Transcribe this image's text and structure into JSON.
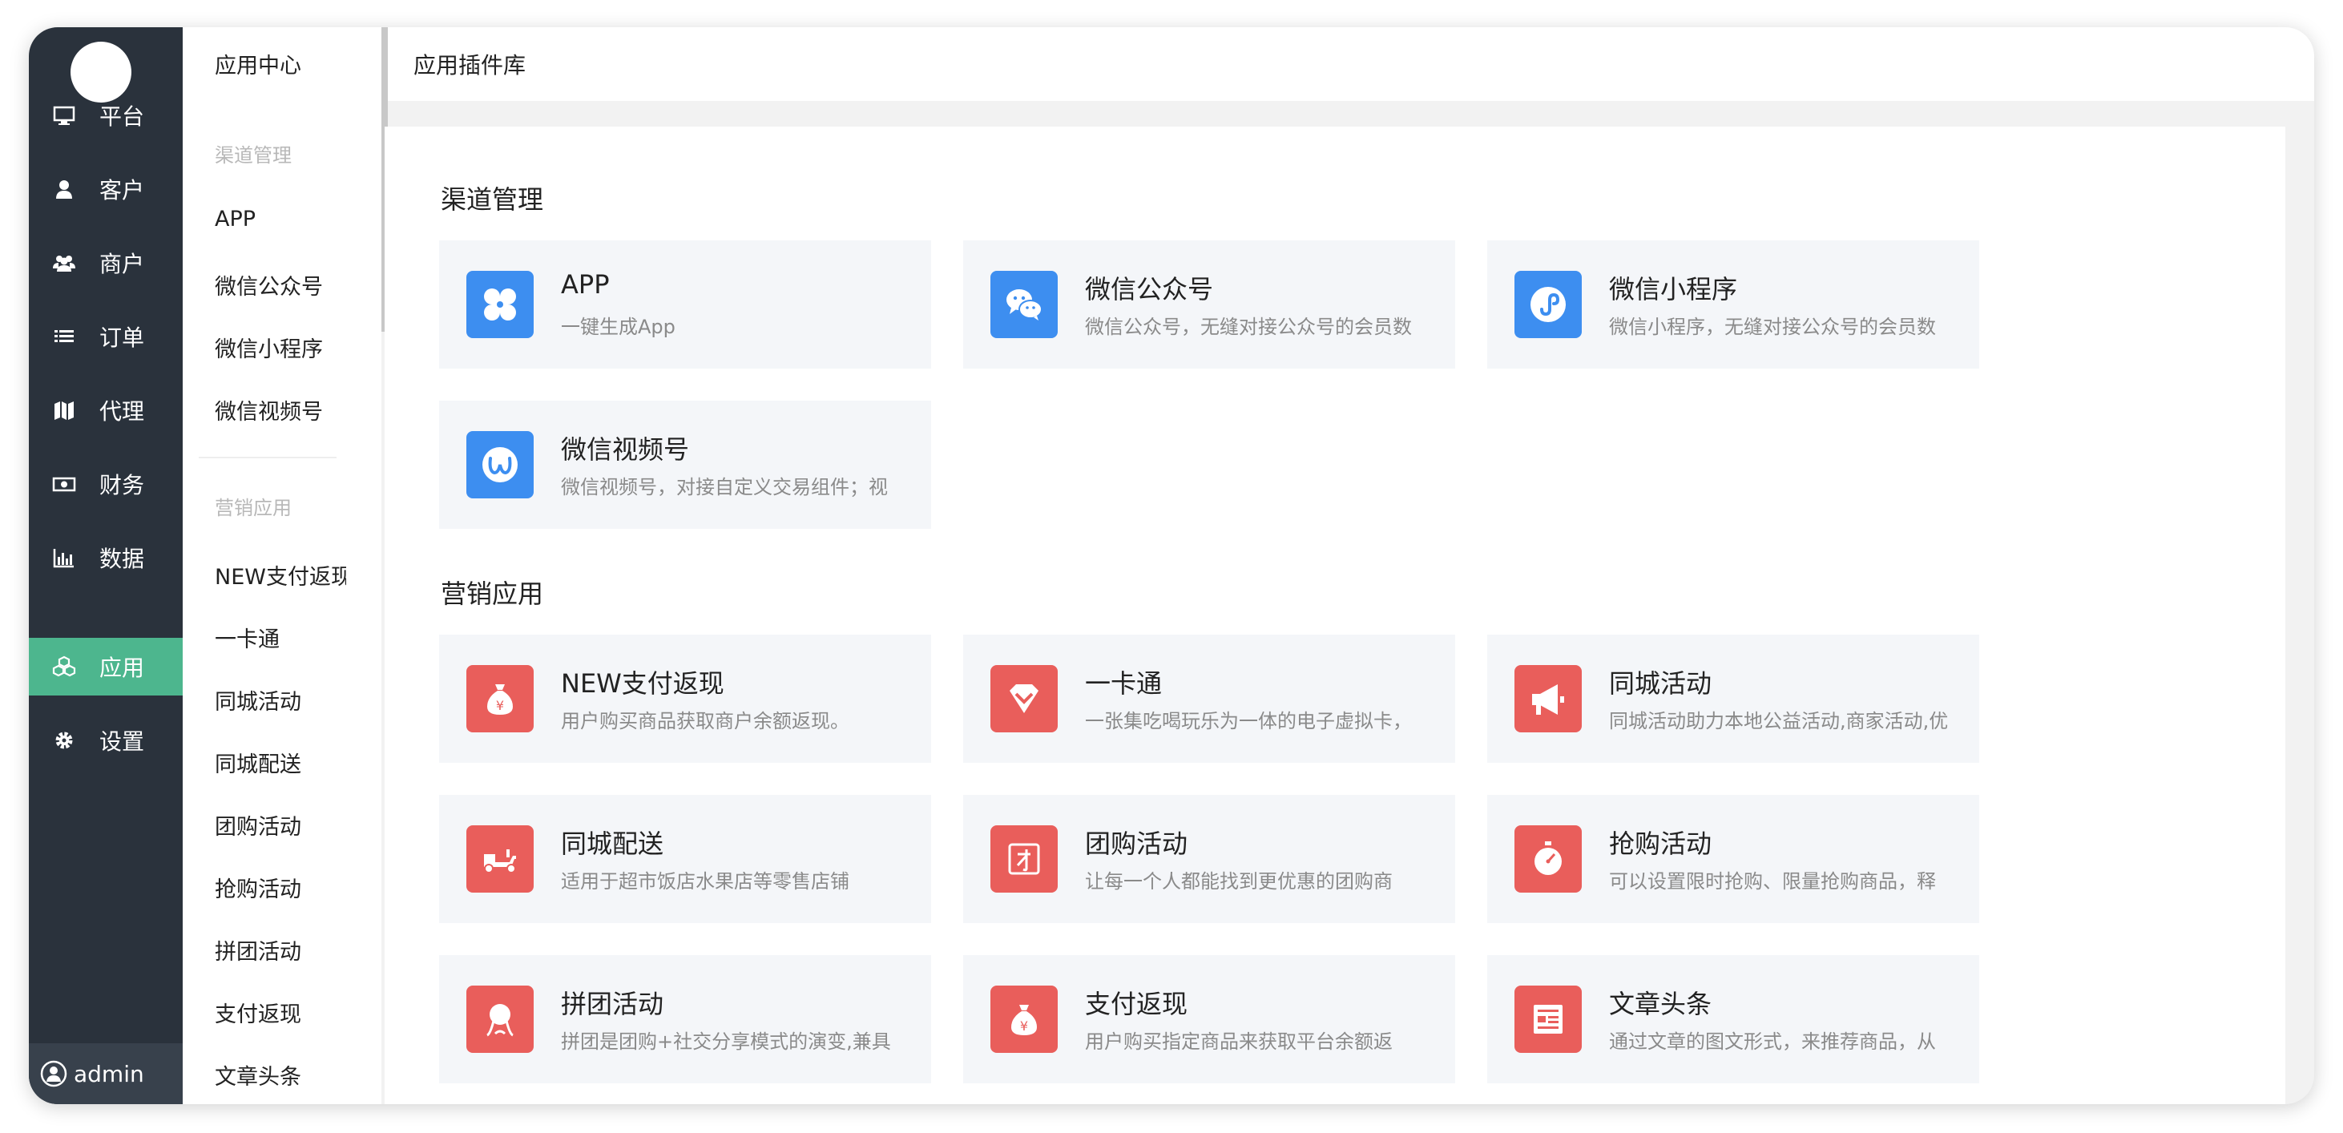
{
  "nav": {
    "items": [
      {
        "label": "平台",
        "icon": "monitor-icon"
      },
      {
        "label": "客户",
        "icon": "user-icon"
      },
      {
        "label": "商户",
        "icon": "users-icon"
      },
      {
        "label": "订单",
        "icon": "list-icon"
      },
      {
        "label": "代理",
        "icon": "map-icon"
      },
      {
        "label": "财务",
        "icon": "money-icon"
      },
      {
        "label": "数据",
        "icon": "bar-chart-icon"
      },
      {
        "label": "应用",
        "icon": "cubes-icon",
        "active": true
      },
      {
        "label": "设置",
        "icon": "gear-icon"
      }
    ],
    "user": "admin"
  },
  "sub": {
    "title": "应用中心",
    "group1": "渠道管理",
    "group1_items": [
      "APP",
      "微信公众号",
      "微信小程序",
      "微信视频号"
    ],
    "group2": "营销应用",
    "group2_items": [
      "NEW支付返现",
      "一卡通",
      "同城活动",
      "同城配送",
      "团购活动",
      "抢购活动",
      "拼团活动",
      "支付返现",
      "文章头条"
    ]
  },
  "topbar": {
    "tab": "应用插件库"
  },
  "sections": {
    "channel": {
      "title": "渠道管理",
      "cards": [
        {
          "title": "APP",
          "desc": "一键生成App",
          "icon": "app-grid-icon",
          "color": "#3d8ef0"
        },
        {
          "title": "微信公众号",
          "desc": "微信公众号，无缝对接公众号的会员数",
          "icon": "wechat-icon",
          "color": "#3d8ef0"
        },
        {
          "title": "微信小程序",
          "desc": "微信小程序，无缝对接公众号的会员数",
          "icon": "mini-program-icon",
          "color": "#3d8ef0"
        },
        {
          "title": "微信视频号",
          "desc": "微信视频号，对接自定义交易组件；视",
          "icon": "channels-icon",
          "color": "#3d8ef0"
        }
      ]
    },
    "marketing": {
      "title": "营销应用",
      "cards": [
        {
          "title": "NEW支付返现",
          "desc": "用户购买商品获取商户余额返现。",
          "icon": "money-bag-icon",
          "color": "#e95e5b"
        },
        {
          "title": "一卡通",
          "desc": "一张集吃喝玩乐为一体的电子虚拟卡，",
          "icon": "diamond-icon",
          "color": "#e95e5b"
        },
        {
          "title": "同城活动",
          "desc": "同城活动助力本地公益活动,商家活动,优",
          "icon": "megaphone-icon",
          "color": "#e95e5b"
        },
        {
          "title": "同城配送",
          "desc": "适用于超市饭店水果店等零售店铺",
          "icon": "scooter-icon",
          "color": "#e95e5b"
        },
        {
          "title": "团购活动",
          "desc": "让每一个人都能找到更优惠的团购商",
          "icon": "group-tag-icon",
          "color": "#e95e5b"
        },
        {
          "title": "抢购活动",
          "desc": "可以设置限时抢购、限量抢购商品，释",
          "icon": "stopwatch-icon",
          "color": "#e95e5b"
        },
        {
          "title": "拼团活动",
          "desc": "拼团是团购+社交分享模式的演变,兼具",
          "icon": "person-icon",
          "color": "#e95e5b"
        },
        {
          "title": "支付返现",
          "desc": "用户购买指定商品来获取平台余额返",
          "icon": "money-bag-icon",
          "color": "#e95e5b"
        },
        {
          "title": "文章头条",
          "desc": "通过文章的图文形式，来推荐商品，从",
          "icon": "article-icon",
          "color": "#e95e5b"
        }
      ]
    }
  }
}
